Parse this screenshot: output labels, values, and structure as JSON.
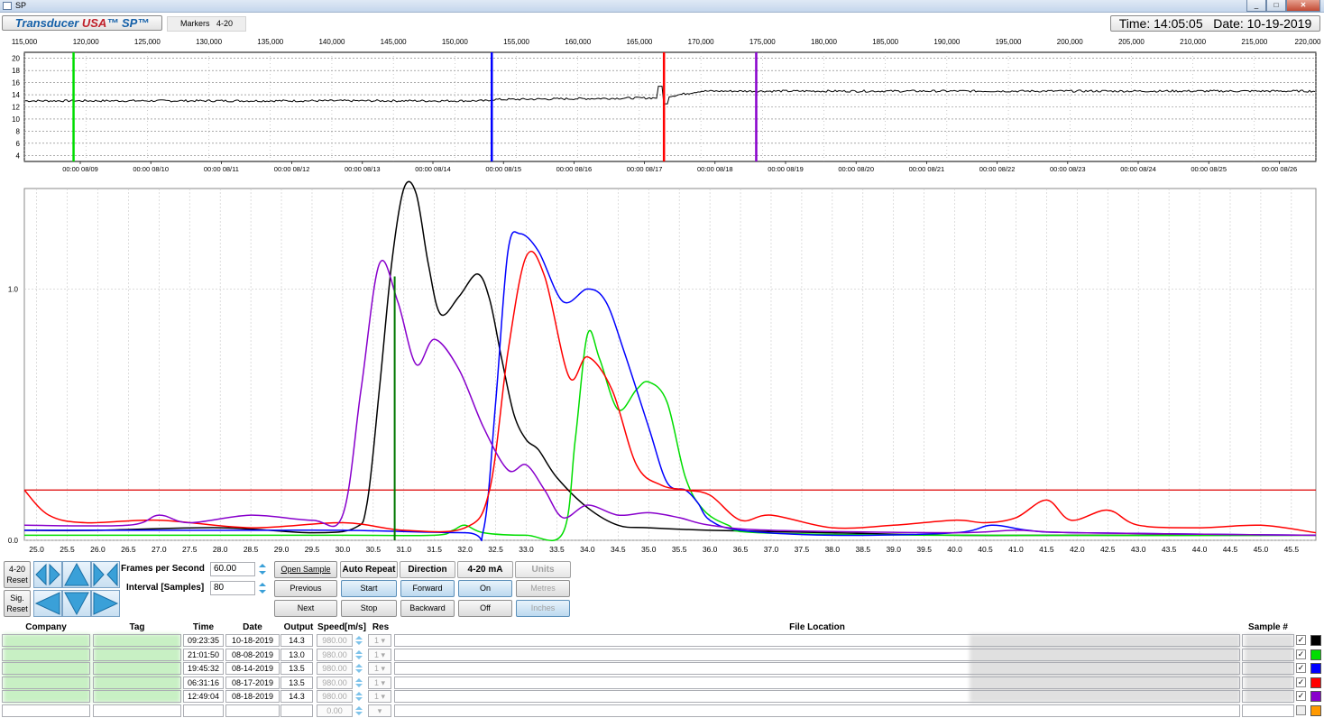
{
  "window": {
    "title": "SP",
    "minimize": "_",
    "maximize": "□",
    "close": "✕"
  },
  "brand": {
    "part1": "Transducer ",
    "part2": "USA",
    "part3": "™ SP™"
  },
  "tab_label": "Markers   4-20",
  "clock": "Time: 14:05:05   Date: 10-19-2019",
  "overview": {
    "x_ticks": [
      "115,000",
      "120,000",
      "125,000",
      "130,000",
      "135,000",
      "140,000",
      "145,000",
      "150,000",
      "155,000",
      "160,000",
      "165,000",
      "170,000",
      "175,000",
      "180,000",
      "185,000",
      "190,000",
      "195,000",
      "200,000",
      "205,000",
      "210,000",
      "215,000",
      "220,000"
    ],
    "y_ticks": [
      "20",
      "18",
      "16",
      "14",
      "12",
      "10",
      "8",
      "6",
      "4"
    ],
    "date_ticks": [
      "00:00 08/09",
      "00:00 08/10",
      "00:00 08/11",
      "00:00 08/12",
      "00:00 08/13",
      "00:00 08/14",
      "00:00 08/15",
      "00:00 08/16",
      "00:00 08/17",
      "00:00 08/18",
      "00:00 08/19",
      "00:00 08/20",
      "00:00 08/21",
      "00:00 08/22",
      "00:00 08/23",
      "00:00 08/24",
      "00:00 08/25",
      "00:00 08/26"
    ],
    "markers": [
      {
        "color": "#00dd00",
        "x": 119000
      },
      {
        "color": "#0000ff",
        "x": 153000
      },
      {
        "color": "#ff0000",
        "x": 167000
      },
      {
        "color": "#8800cc",
        "x": 174500
      }
    ],
    "colors": {
      "trace": "#000000"
    }
  },
  "chart_data": {
    "type": "line",
    "xlim": [
      24.8,
      45.9
    ],
    "ylim": [
      0.0,
      1.4
    ],
    "y_ticks": [
      "1.0",
      "0.0"
    ],
    "y_tick_values": [
      1.0,
      0.0
    ],
    "x_ticks": [
      "25.0",
      "25.5",
      "26.0",
      "26.5",
      "27.0",
      "27.5",
      "28.0",
      "28.5",
      "29.0",
      "29.5",
      "30.0",
      "30.5",
      "31.0",
      "31.5",
      "32.0",
      "32.5",
      "33.0",
      "33.5",
      "34.0",
      "34.5",
      "35.0",
      "35.5",
      "36.0",
      "36.5",
      "37.0",
      "37.5",
      "38.0",
      "38.5",
      "39.0",
      "39.5",
      "40.0",
      "40.5",
      "41.0",
      "41.5",
      "42.0",
      "42.5",
      "43.0",
      "43.5",
      "44.0",
      "44.5",
      "45.0",
      "45.5"
    ],
    "grid": true,
    "threshold": 0.2,
    "vertical_marker": 30.85,
    "series": [
      {
        "color": "#000000",
        "points": [
          [
            24.8,
            0.04
          ],
          [
            26.0,
            0.04
          ],
          [
            28.0,
            0.05
          ],
          [
            29.5,
            0.03
          ],
          [
            30.2,
            0.05
          ],
          [
            30.4,
            0.15
          ],
          [
            30.6,
            0.6
          ],
          [
            30.8,
            1.1
          ],
          [
            31.0,
            1.4
          ],
          [
            31.2,
            1.38
          ],
          [
            31.4,
            1.1
          ],
          [
            31.6,
            0.9
          ],
          [
            31.9,
            0.97
          ],
          [
            32.2,
            1.06
          ],
          [
            32.4,
            0.96
          ],
          [
            32.6,
            0.72
          ],
          [
            32.8,
            0.5
          ],
          [
            33.0,
            0.4
          ],
          [
            33.2,
            0.36
          ],
          [
            33.5,
            0.25
          ],
          [
            34.0,
            0.13
          ],
          [
            34.5,
            0.06
          ],
          [
            35.0,
            0.05
          ],
          [
            36.0,
            0.04
          ],
          [
            38.0,
            0.03
          ],
          [
            40.0,
            0.02
          ],
          [
            42.0,
            0.02
          ],
          [
            45.9,
            0.02
          ]
        ]
      },
      {
        "color": "#00dd00",
        "points": [
          [
            24.8,
            0.02
          ],
          [
            30.0,
            0.02
          ],
          [
            31.5,
            0.02
          ],
          [
            31.8,
            0.04
          ],
          [
            32.0,
            0.06
          ],
          [
            32.3,
            0.03
          ],
          [
            33.0,
            0.02
          ],
          [
            33.6,
            0.03
          ],
          [
            33.8,
            0.4
          ],
          [
            34.0,
            0.82
          ],
          [
            34.2,
            0.72
          ],
          [
            34.5,
            0.52
          ],
          [
            34.8,
            0.6
          ],
          [
            35.0,
            0.63
          ],
          [
            35.3,
            0.55
          ],
          [
            35.6,
            0.25
          ],
          [
            35.9,
            0.12
          ],
          [
            36.3,
            0.06
          ],
          [
            36.8,
            0.03
          ],
          [
            40.0,
            0.02
          ],
          [
            45.9,
            0.02
          ]
        ]
      },
      {
        "color": "#0000ff",
        "points": [
          [
            24.8,
            0.04
          ],
          [
            28.5,
            0.04
          ],
          [
            30.0,
            0.04
          ],
          [
            32.0,
            0.03
          ],
          [
            32.3,
            0.04
          ],
          [
            32.5,
            0.55
          ],
          [
            32.7,
            1.15
          ],
          [
            32.9,
            1.22
          ],
          [
            33.2,
            1.15
          ],
          [
            33.6,
            0.95
          ],
          [
            34.0,
            1.0
          ],
          [
            34.3,
            0.95
          ],
          [
            34.6,
            0.75
          ],
          [
            35.0,
            0.45
          ],
          [
            35.3,
            0.23
          ],
          [
            35.6,
            0.2
          ],
          [
            35.8,
            0.15
          ],
          [
            36.0,
            0.08
          ],
          [
            36.5,
            0.04
          ],
          [
            38.0,
            0.02
          ],
          [
            40.0,
            0.03
          ],
          [
            40.6,
            0.06
          ],
          [
            41.2,
            0.04
          ],
          [
            42.0,
            0.03
          ],
          [
            45.9,
            0.02
          ]
        ]
      },
      {
        "color": "#ff0000",
        "points": [
          [
            24.8,
            0.2
          ],
          [
            25.2,
            0.1
          ],
          [
            25.8,
            0.07
          ],
          [
            27.0,
            0.08
          ],
          [
            28.5,
            0.05
          ],
          [
            30.0,
            0.07
          ],
          [
            31.0,
            0.04
          ],
          [
            32.0,
            0.05
          ],
          [
            32.4,
            0.2
          ],
          [
            32.7,
            0.75
          ],
          [
            33.0,
            1.13
          ],
          [
            33.3,
            1.05
          ],
          [
            33.7,
            0.65
          ],
          [
            34.0,
            0.73
          ],
          [
            34.4,
            0.6
          ],
          [
            34.8,
            0.3
          ],
          [
            35.2,
            0.22
          ],
          [
            35.6,
            0.2
          ],
          [
            36.0,
            0.18
          ],
          [
            36.5,
            0.08
          ],
          [
            37.0,
            0.1
          ],
          [
            38.0,
            0.05
          ],
          [
            39.0,
            0.06
          ],
          [
            40.0,
            0.08
          ],
          [
            40.5,
            0.07
          ],
          [
            41.0,
            0.09
          ],
          [
            41.5,
            0.16
          ],
          [
            41.9,
            0.08
          ],
          [
            42.5,
            0.12
          ],
          [
            43.0,
            0.06
          ],
          [
            44.0,
            0.05
          ],
          [
            45.0,
            0.06
          ],
          [
            45.9,
            0.03
          ]
        ]
      },
      {
        "color": "#8800cc",
        "points": [
          [
            24.8,
            0.06
          ],
          [
            26.5,
            0.06
          ],
          [
            27.0,
            0.1
          ],
          [
            27.5,
            0.07
          ],
          [
            28.5,
            0.1
          ],
          [
            29.5,
            0.08
          ],
          [
            30.0,
            0.1
          ],
          [
            30.3,
            0.6
          ],
          [
            30.6,
            1.1
          ],
          [
            30.9,
            0.95
          ],
          [
            31.2,
            0.7
          ],
          [
            31.5,
            0.8
          ],
          [
            31.9,
            0.68
          ],
          [
            32.3,
            0.45
          ],
          [
            32.7,
            0.28
          ],
          [
            33.0,
            0.3
          ],
          [
            33.3,
            0.2
          ],
          [
            33.6,
            0.09
          ],
          [
            34.0,
            0.14
          ],
          [
            34.5,
            0.1
          ],
          [
            35.0,
            0.11
          ],
          [
            35.5,
            0.09
          ],
          [
            36.0,
            0.06
          ],
          [
            37.0,
            0.04
          ],
          [
            40.0,
            0.03
          ],
          [
            41.0,
            0.04
          ],
          [
            42.0,
            0.03
          ],
          [
            45.9,
            0.02
          ]
        ]
      }
    ]
  },
  "controls": {
    "reset_420": "4-20\nReset",
    "sig_reset": "Sig.\nReset",
    "fps_label": "Frames per Second",
    "fps_value": "60.00",
    "interval_label": "Interval [Samples]",
    "interval_value": "80",
    "open_sample": "Open Sample",
    "previous": "Previous",
    "next": "Next",
    "auto_repeat": "Auto Repeat",
    "start": "Start",
    "stop": "Stop",
    "direction": "Direction",
    "forward": "Forward",
    "backward": "Backward",
    "ma_420": "4-20 mA",
    "on": "On",
    "off": "Off",
    "units": "Units",
    "metres": "Metres",
    "inches": "Inches"
  },
  "table": {
    "headers": {
      "company": "Company",
      "tag": "Tag",
      "time": "Time",
      "date": "Date",
      "output": "Output",
      "speed": "Speed[m/s]",
      "res": "Res",
      "file": "File Location",
      "sample": "Sample #"
    },
    "rows": [
      {
        "time": "09:23:35",
        "date": "10-18-2019",
        "output": "14.3",
        "speed": "980.00",
        "res": "1",
        "check": "✓",
        "color": "#000000"
      },
      {
        "time": "21:01:50",
        "date": "08-08-2019",
        "output": "13.0",
        "speed": "980.00",
        "res": "1",
        "check": "✓",
        "color": "#00dd00"
      },
      {
        "time": "19:45:32",
        "date": "08-14-2019",
        "output": "13.5",
        "speed": "980.00",
        "res": "1",
        "check": "✓",
        "color": "#0000ff"
      },
      {
        "time": "06:31:16",
        "date": "08-17-2019",
        "output": "13.5",
        "speed": "980.00",
        "res": "1",
        "check": "✓",
        "color": "#ff0000"
      },
      {
        "time": "12:49:04",
        "date": "08-18-2019",
        "output": "14.3",
        "speed": "980.00",
        "res": "1",
        "check": "✓",
        "color": "#8800cc"
      }
    ],
    "empty_row": {
      "speed": "0.00",
      "color": "#ff9900"
    }
  }
}
